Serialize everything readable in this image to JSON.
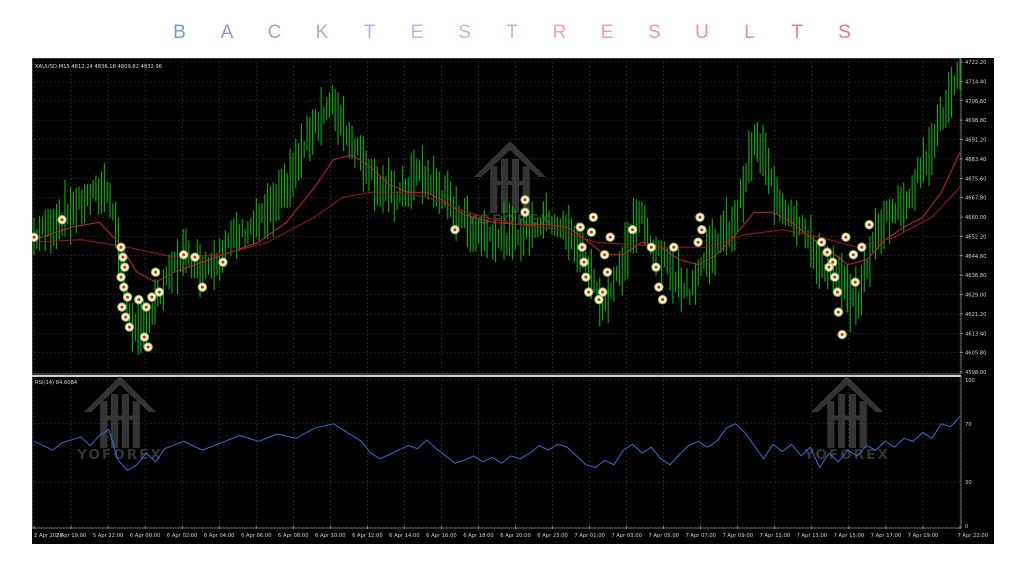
{
  "title": "BACKTESTRESULTS",
  "title_colors": [
    "#7b97d6",
    "#8f9ad8",
    "#a3a0db",
    "#b3a6dc",
    "#c2aae0",
    "#cfaee2",
    "#d8acdc",
    "#e1a9d2",
    "#e8a3c4",
    "#ee9cb6",
    "#f195a8",
    "#f38d9a",
    "#f48490",
    "#f47c86",
    "#f3737c"
  ],
  "colors": {
    "background": "#000000",
    "grid": "#3a3a3a",
    "candle_up": "#00b300",
    "ma_fast": "#c0202a",
    "ma_slow": "#901818",
    "rsi_line": "#2f6fd6",
    "axis_text": "#d0d0d0",
    "watermark": "#606060"
  },
  "watermark": {
    "text": "YOFOREX",
    "icon": "house-arrow-logo"
  },
  "chart_data": [
    {
      "type": "line",
      "name": "price-panel",
      "header": "XAUUSD,M15  4812.24 4836.18 4809.82 4832.96",
      "ylim": [
        4598.0,
        4722.2
      ],
      "yticks": [
        "4722.20",
        "4714.40",
        "4706.60",
        "4698.80",
        "4691.20",
        "4683.40",
        "4675.60",
        "4667.80",
        "4660.00",
        "4652.20",
        "4644.60",
        "4636.80",
        "4629.00",
        "4621.20",
        "4613.40",
        "4605.80",
        "4598.00"
      ],
      "xticks": [
        "2 Apr 2026",
        "2 Apr 19:00",
        "5 Apr 22:00",
        "6 Apr 00:00",
        "6 Apr 02:00",
        "6 Apr 04:00",
        "6 Apr 06:00",
        "6 Apr 08:00",
        "6 Apr 10:00",
        "6 Apr 12:00",
        "6 Apr 14:00",
        "6 Apr 16:00",
        "6 Apr 18:00",
        "6 Apr 20:00",
        "6 Apr 23:00",
        "7 Apr 01:00",
        "7 Apr 03:00",
        "7 Apr 05:00",
        "7 Apr 07:00",
        "7 Apr 09:00",
        "7 Apr 11:00",
        "7 Apr 13:00",
        "7 Apr 15:00",
        "7 Apr 17:00",
        "7 Apr 19:00",
        "7 Apr 22:00"
      ],
      "price_path": [
        [
          0,
          4652
        ],
        [
          3,
          4660
        ],
        [
          6,
          4668
        ],
        [
          8,
          4672
        ],
        [
          9,
          4650
        ],
        [
          10,
          4625
        ],
        [
          11,
          4612
        ],
        [
          12,
          4618
        ],
        [
          13,
          4625
        ],
        [
          15,
          4640
        ],
        [
          16,
          4645
        ],
        [
          18,
          4640
        ],
        [
          19,
          4642
        ],
        [
          21,
          4650
        ],
        [
          24,
          4658
        ],
        [
          26,
          4665
        ],
        [
          28,
          4680
        ],
        [
          30,
          4698
        ],
        [
          32,
          4705
        ],
        [
          33,
          4698
        ],
        [
          34,
          4690
        ],
        [
          35,
          4685
        ],
        [
          37,
          4672
        ],
        [
          39,
          4668
        ],
        [
          40,
          4672
        ],
        [
          41,
          4678
        ],
        [
          43,
          4672
        ],
        [
          45,
          4663
        ],
        [
          47,
          4655
        ],
        [
          49,
          4653
        ],
        [
          51,
          4652
        ],
        [
          53,
          4655
        ],
        [
          55,
          4660
        ],
        [
          56,
          4657
        ],
        [
          58,
          4650
        ],
        [
          59,
          4642
        ],
        [
          60,
          4632
        ],
        [
          61,
          4625
        ],
        [
          62,
          4633
        ],
        [
          63,
          4642
        ],
        [
          64,
          4655
        ],
        [
          65,
          4660
        ],
        [
          66,
          4648
        ],
        [
          68,
          4640
        ],
        [
          70,
          4630
        ],
        [
          71,
          4638
        ],
        [
          72,
          4645
        ],
        [
          73,
          4650
        ],
        [
          75,
          4658
        ],
        [
          76,
          4675
        ],
        [
          77,
          4690
        ],
        [
          78,
          4685
        ],
        [
          79,
          4672
        ],
        [
          80,
          4665
        ],
        [
          82,
          4658
        ],
        [
          83,
          4648
        ],
        [
          84,
          4642
        ],
        [
          86,
          4635
        ],
        [
          87,
          4630
        ],
        [
          88,
          4625
        ],
        [
          89,
          4640
        ],
        [
          90,
          4652
        ],
        [
          91,
          4660
        ],
        [
          93,
          4665
        ],
        [
          95,
          4680
        ],
        [
          96,
          4690
        ],
        [
          97,
          4700
        ],
        [
          98,
          4708
        ],
        [
          99,
          4717
        ]
      ],
      "ma_fast": [
        [
          0,
          4651
        ],
        [
          4,
          4656
        ],
        [
          7,
          4658
        ],
        [
          9,
          4650
        ],
        [
          11,
          4638
        ],
        [
          13,
          4634
        ],
        [
          15,
          4638
        ],
        [
          18,
          4642
        ],
        [
          21,
          4646
        ],
        [
          24,
          4650
        ],
        [
          27,
          4658
        ],
        [
          30,
          4672
        ],
        [
          32,
          4683
        ],
        [
          34,
          4685
        ],
        [
          36,
          4680
        ],
        [
          38,
          4673
        ],
        [
          40,
          4670
        ],
        [
          42,
          4670
        ],
        [
          44,
          4666
        ],
        [
          46,
          4661
        ],
        [
          49,
          4658
        ],
        [
          52,
          4657
        ],
        [
          55,
          4657
        ],
        [
          57,
          4656
        ],
        [
          59,
          4651
        ],
        [
          61,
          4645
        ],
        [
          63,
          4645
        ],
        [
          65,
          4650
        ],
        [
          67,
          4648
        ],
        [
          69,
          4643
        ],
        [
          71,
          4641
        ],
        [
          73,
          4645
        ],
        [
          75,
          4653
        ],
        [
          77,
          4662
        ],
        [
          79,
          4662
        ],
        [
          81,
          4658
        ],
        [
          83,
          4652
        ],
        [
          85,
          4647
        ],
        [
          87,
          4641
        ],
        [
          89,
          4643
        ],
        [
          91,
          4651
        ],
        [
          93,
          4656
        ],
        [
          95,
          4660
        ],
        [
          97,
          4670
        ],
        [
          99,
          4686
        ]
      ],
      "ma_slow": [
        [
          0,
          4650
        ],
        [
          5,
          4651
        ],
        [
          10,
          4648
        ],
        [
          15,
          4644
        ],
        [
          20,
          4645
        ],
        [
          25,
          4650
        ],
        [
          30,
          4660
        ],
        [
          33,
          4668
        ],
        [
          36,
          4670
        ],
        [
          39,
          4670
        ],
        [
          42,
          4668
        ],
        [
          45,
          4664
        ],
        [
          48,
          4660
        ],
        [
          52,
          4657
        ],
        [
          56,
          4655
        ],
        [
          60,
          4650
        ],
        [
          64,
          4649
        ],
        [
          68,
          4648
        ],
        [
          72,
          4648
        ],
        [
          76,
          4653
        ],
        [
          80,
          4655
        ],
        [
          84,
          4652
        ],
        [
          88,
          4648
        ],
        [
          92,
          4652
        ],
        [
          96,
          4660
        ],
        [
          99,
          4672
        ]
      ],
      "trade_markers": [
        [
          0,
          4652
        ],
        [
          3,
          4659
        ],
        [
          9.3,
          4648
        ],
        [
          9.5,
          4644
        ],
        [
          9.7,
          4640
        ],
        [
          9.3,
          4636
        ],
        [
          9.6,
          4632
        ],
        [
          10,
          4628
        ],
        [
          9.4,
          4624
        ],
        [
          9.8,
          4620
        ],
        [
          10.2,
          4616
        ],
        [
          11.2,
          4627
        ],
        [
          12,
          4624
        ],
        [
          12.6,
          4628
        ],
        [
          13,
          4638
        ],
        [
          13.4,
          4630
        ],
        [
          11.8,
          4612
        ],
        [
          12.2,
          4608
        ],
        [
          16,
          4645
        ],
        [
          17.2,
          4644
        ],
        [
          18,
          4632
        ],
        [
          20.2,
          4642
        ],
        [
          45,
          4655
        ],
        [
          52.5,
          4667
        ],
        [
          52.5,
          4662
        ],
        [
          58.4,
          4656
        ],
        [
          58.6,
          4648
        ],
        [
          58.8,
          4642
        ],
        [
          59,
          4636
        ],
        [
          59.3,
          4630
        ],
        [
          59.6,
          4654
        ],
        [
          60.4,
          4627
        ],
        [
          60.8,
          4630
        ],
        [
          61,
          4645
        ],
        [
          61.3,
          4638
        ],
        [
          61.6,
          4652
        ],
        [
          59.8,
          4660
        ],
        [
          64,
          4655
        ],
        [
          66,
          4648
        ],
        [
          66.5,
          4640
        ],
        [
          66.8,
          4632
        ],
        [
          67.2,
          4627
        ],
        [
          68.4,
          4648
        ],
        [
          71,
          4650
        ],
        [
          71.2,
          4660
        ],
        [
          71.4,
          4655
        ],
        [
          84.2,
          4650
        ],
        [
          84.8,
          4646
        ],
        [
          85.4,
          4642
        ],
        [
          85.6,
          4636
        ],
        [
          85.9,
          4630
        ],
        [
          86,
          4622
        ],
        [
          86.4,
          4613
        ],
        [
          85,
          4640
        ],
        [
          86.8,
          4652
        ],
        [
          87.6,
          4645
        ],
        [
          87.8,
          4634
        ],
        [
          88.5,
          4648
        ],
        [
          89.3,
          4657
        ]
      ]
    },
    {
      "type": "line",
      "name": "rsi-panel",
      "header": "RSI(14) 84.6084",
      "ylim": [
        0,
        100
      ],
      "yticks": [
        "100",
        "70",
        "30",
        "0"
      ],
      "levels": [
        70,
        30
      ],
      "values": [
        [
          0,
          58
        ],
        [
          2,
          52
        ],
        [
          3,
          57
        ],
        [
          5,
          61
        ],
        [
          6,
          55
        ],
        [
          7,
          62
        ],
        [
          8,
          66
        ],
        [
          9,
          45
        ],
        [
          10,
          38
        ],
        [
          11,
          42
        ],
        [
          12,
          50
        ],
        [
          13,
          44
        ],
        [
          14,
          53
        ],
        [
          16,
          58
        ],
        [
          18,
          52
        ],
        [
          20,
          57
        ],
        [
          22,
          62
        ],
        [
          24,
          58
        ],
        [
          26,
          63
        ],
        [
          28,
          60
        ],
        [
          30,
          67
        ],
        [
          32,
          70
        ],
        [
          33,
          66
        ],
        [
          34,
          62
        ],
        [
          35,
          58
        ],
        [
          36,
          50
        ],
        [
          37,
          46
        ],
        [
          38,
          49
        ],
        [
          39,
          52
        ],
        [
          40,
          55
        ],
        [
          41,
          53
        ],
        [
          42,
          59
        ],
        [
          43,
          53
        ],
        [
          44,
          48
        ],
        [
          45,
          43
        ],
        [
          46,
          45
        ],
        [
          47,
          48
        ],
        [
          48,
          44
        ],
        [
          49,
          47
        ],
        [
          50,
          43
        ],
        [
          51,
          48
        ],
        [
          52,
          46
        ],
        [
          53,
          50
        ],
        [
          54,
          55
        ],
        [
          55,
          52
        ],
        [
          56,
          56
        ],
        [
          57,
          54
        ],
        [
          58,
          48
        ],
        [
          59,
          42
        ],
        [
          60,
          40
        ],
        [
          61,
          45
        ],
        [
          62,
          42
        ],
        [
          63,
          52
        ],
        [
          64,
          56
        ],
        [
          65,
          50
        ],
        [
          66,
          54
        ],
        [
          67,
          46
        ],
        [
          68,
          42
        ],
        [
          69,
          49
        ],
        [
          70,
          55
        ],
        [
          71,
          58
        ],
        [
          72,
          54
        ],
        [
          73,
          58
        ],
        [
          74,
          67
        ],
        [
          75,
          70
        ],
        [
          76,
          64
        ],
        [
          77,
          55
        ],
        [
          78,
          46
        ],
        [
          79,
          56
        ],
        [
          80,
          51
        ],
        [
          81,
          56
        ],
        [
          82,
          48
        ],
        [
          83,
          54
        ],
        [
          84,
          40
        ],
        [
          85,
          50
        ],
        [
          86,
          44
        ],
        [
          87,
          52
        ],
        [
          88,
          48
        ],
        [
          89,
          55
        ],
        [
          90,
          52
        ],
        [
          91,
          58
        ],
        [
          92,
          54
        ],
        [
          93,
          60
        ],
        [
          94,
          58
        ],
        [
          95,
          64
        ],
        [
          96,
          60
        ],
        [
          97,
          70
        ],
        [
          98,
          68
        ],
        [
          99,
          75
        ]
      ]
    }
  ]
}
